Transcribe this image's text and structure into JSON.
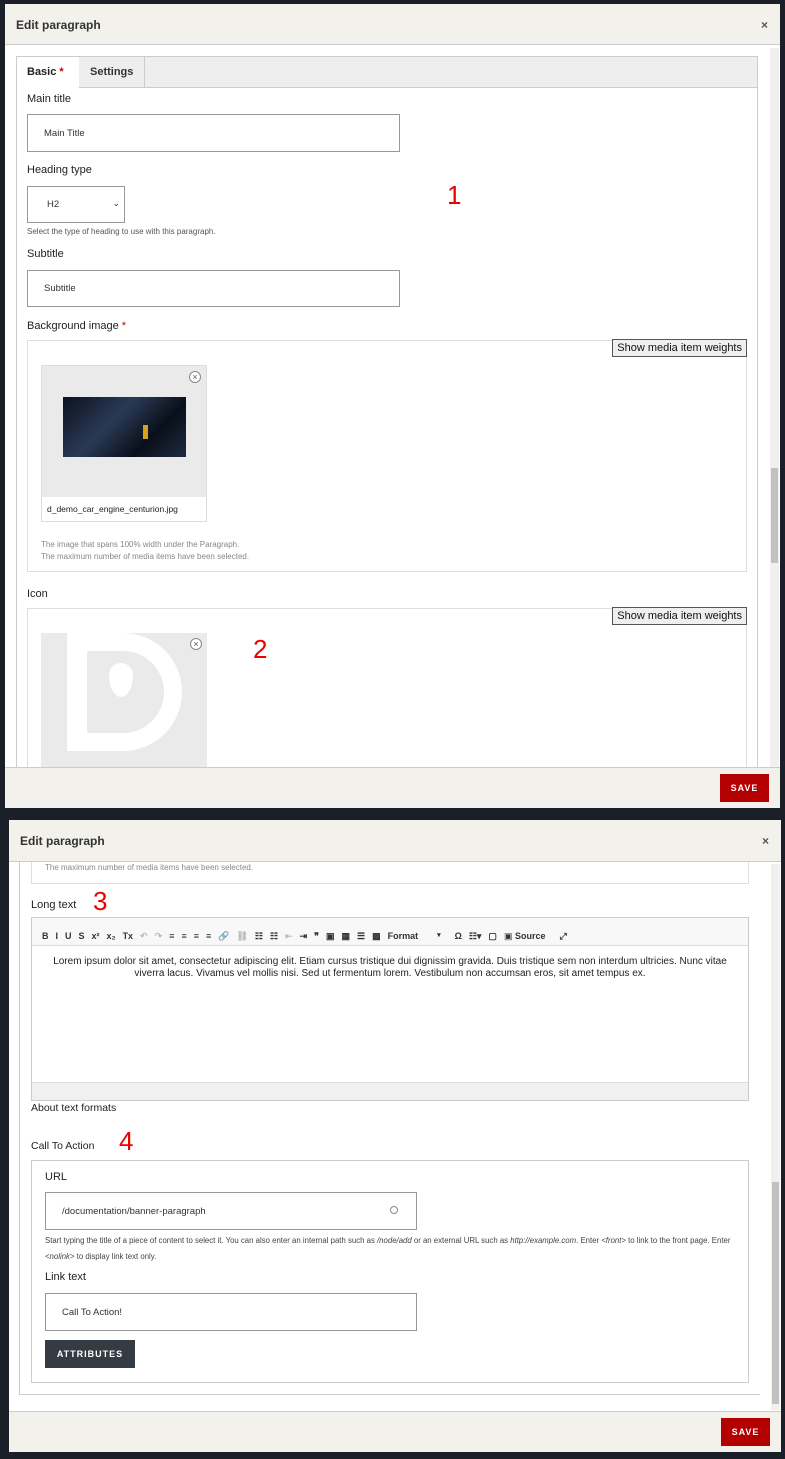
{
  "dialog_title": "Edit paragraph",
  "close_icon": "×",
  "save_label": "SAVE",
  "tabs": [
    {
      "label": "Basic",
      "required": "*"
    },
    {
      "label": "Settings"
    }
  ],
  "main_title": {
    "label": "Main title",
    "value": "Main Title"
  },
  "heading_type": {
    "label": "Heading type",
    "value": "H2",
    "description": "Select the type of heading to use with this paragraph."
  },
  "subtitle": {
    "label": "Subtitle",
    "value": "Subtitle"
  },
  "background_image": {
    "label": "Background image",
    "required": "*",
    "weights_button": "Show media item weights",
    "filename": "d_demo_car_engine_centurion.jpg",
    "description": "The image that spans 100% width under the Paragraph.",
    "max_note": "The maximum number of media items have been selected."
  },
  "icon_field": {
    "label": "Icon",
    "weights_button": "Show media item weights"
  },
  "annotations": [
    "1",
    "2",
    "3",
    "4"
  ],
  "long_text": {
    "label": "Long text",
    "toolbar": [
      "B",
      "I",
      "U",
      "S",
      "x²",
      "x₂",
      "Tx",
      "↶",
      "↷",
      "≡",
      "≡",
      "≡",
      "≡",
      "🔗",
      "⛓",
      "☷",
      "☷",
      "⇤",
      "⇥",
      "❞",
      "▣",
      "▦",
      "☰",
      "▩"
    ],
    "format_label": "Format",
    "source_label": "Source",
    "omega": "Ω",
    "body": "Lorem ipsum dolor sit amet, consectetur adipiscing elit. Etiam cursus tristique dui dignissim gravida. Duis tristique sem non interdum ultricies. Nunc vitae viverra lacus. Vivamus vel mollis nisi. Sed ut fermentum lorem. Vestibulum non accumsan eros, sit amet tempus ex.",
    "about_formats": "About text formats"
  },
  "cta": {
    "label": "Call To Action",
    "url_label": "URL",
    "url_value": "/documentation/banner-paragraph",
    "url_help_1": "Start typing the title of a piece of content to select it. You can also enter an internal path such as ",
    "url_help_em1": "/node/add",
    "url_help_2": " or an external URL such as ",
    "url_help_em2": "http://example.com",
    "url_help_3": ". Enter ",
    "url_help_em3": "<front>",
    "url_help_4": " to link to the front page. Enter ",
    "url_help_em4": "<nolink>",
    "url_help_5": " to display link text only.",
    "link_text_label": "Link text",
    "link_text_value": "Call To Action!",
    "attributes_button": "ATTRIBUTES"
  },
  "colors": {
    "save": "#b30000",
    "required": "#cc0000",
    "annotation": "#ee0000"
  }
}
